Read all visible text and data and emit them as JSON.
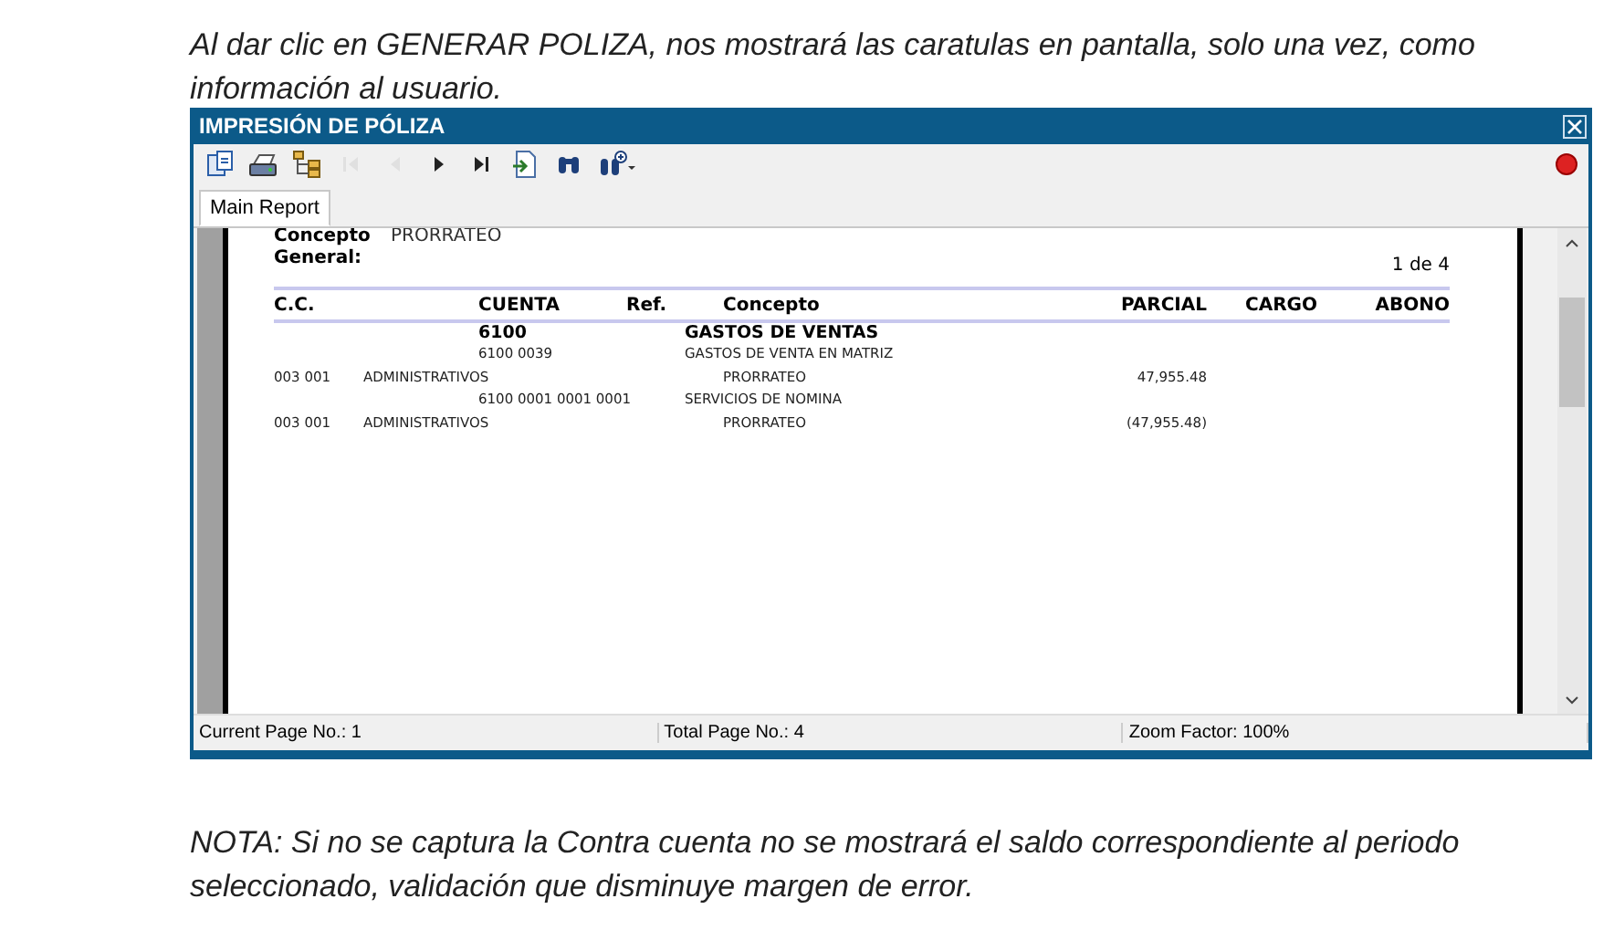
{
  "intro": "Al dar clic en GENERAR POLIZA, nos mostrará las caratulas en pantalla, solo una vez, como información al usuario.",
  "window": {
    "title": "IMPRESIÓN DE PÓLIZA"
  },
  "toolbar": [
    {
      "kind": "export",
      "disabled": false
    },
    {
      "kind": "print",
      "disabled": false
    },
    {
      "kind": "tree",
      "disabled": false
    },
    {
      "kind": "first",
      "disabled": true
    },
    {
      "kind": "prev",
      "disabled": true
    },
    {
      "kind": "next",
      "disabled": false
    },
    {
      "kind": "last",
      "disabled": false
    },
    {
      "kind": "goto",
      "disabled": false
    },
    {
      "kind": "search",
      "disabled": false
    },
    {
      "kind": "zoom",
      "disabled": false
    }
  ],
  "tabs": [
    {
      "label": "Main Report",
      "selected": true
    }
  ],
  "report": {
    "concept_label": "Concepto",
    "concept_value": "PRORRATEO",
    "general_label": "General:",
    "page": "1 de 4",
    "columns": [
      "C.C.",
      "CUENTA",
      "Ref.",
      "Concepto",
      "PARCIAL",
      "CARGO",
      "ABONO"
    ],
    "rows": [
      {
        "kind": "group",
        "cuenta": "6100",
        "concepto": "GASTOS DE VENTAS"
      },
      {
        "kind": "account",
        "cuenta": "6100 0039",
        "concepto": "GASTOS DE VENTA EN MATRIZ"
      },
      {
        "kind": "detail",
        "cc": "003 001",
        "name": "ADMINISTRATIVOS",
        "concepto": "PRORRATEO",
        "parcial": "47,955.48"
      },
      {
        "kind": "account",
        "cuenta": "6100 0001 0001 0001",
        "concepto": "SERVICIOS DE NOMINA"
      },
      {
        "kind": "detail",
        "cc": "003 001",
        "name": "ADMINISTRATIVOS",
        "concepto": "PRORRATEO",
        "parcial": "(47,955.48)"
      }
    ]
  },
  "status_bar": [
    "Current Page No.: 1",
    "Total Page No.: 4",
    "Zoom Factor: 100%"
  ],
  "note": "NOTA: Si no se captura la Contra cuenta no se mostrará el saldo correspondiente al periodo seleccionado, validación que disminuye margen de error."
}
